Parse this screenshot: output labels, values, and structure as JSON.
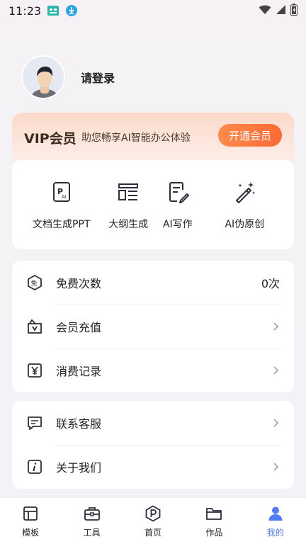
{
  "status_bar": {
    "time": "11:23",
    "icons": [
      "notification-app-icon",
      "download-icon",
      "wifi-icon",
      "signal-icon",
      "battery-icon"
    ]
  },
  "profile": {
    "login_text": "请登录"
  },
  "vip": {
    "title": "VIP会员",
    "description": "助您畅享AI智能办公体验",
    "button_label": "开通会员",
    "accent": "#fb6a34"
  },
  "tools": [
    {
      "label": "文档生成PPT",
      "icon": "ppt-doc-icon"
    },
    {
      "label": "大纲生成",
      "icon": "outline-icon"
    },
    {
      "label": "AI写作",
      "icon": "pen-write-icon"
    },
    {
      "label": "AI伪原创",
      "icon": "magic-wand-icon"
    }
  ],
  "account_list": [
    {
      "label": "免费次数",
      "value": "0次",
      "icon": "free-badge-icon"
    },
    {
      "label": "会员充值",
      "icon": "vip-recharge-icon"
    },
    {
      "label": "消费记录",
      "icon": "yuan-record-icon"
    }
  ],
  "service_list": [
    {
      "label": "联系客服",
      "icon": "chat-icon"
    },
    {
      "label": "关于我们",
      "icon": "info-icon"
    }
  ],
  "nav": {
    "items": [
      {
        "label": "模板",
        "icon": "template-icon"
      },
      {
        "label": "工具",
        "icon": "toolbox-icon"
      },
      {
        "label": "首页",
        "icon": "home-p-icon"
      },
      {
        "label": "作品",
        "icon": "folder-icon"
      },
      {
        "label": "我的",
        "icon": "user-icon"
      }
    ],
    "active_color": "#4e7cf6"
  }
}
